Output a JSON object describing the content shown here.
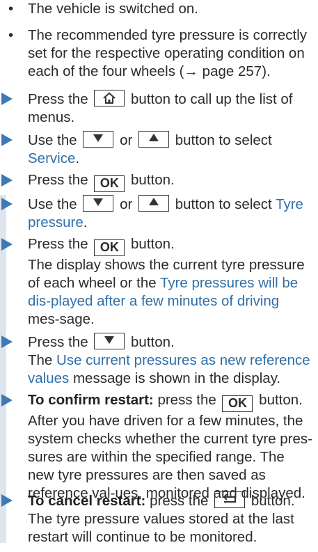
{
  "requirements": [
    "The vehicle is switched on.",
    "The recommended tyre pressure is correctly set for the respective operating condition on each of the four wheels (→ page 257)."
  ],
  "steps": {
    "s1": {
      "pre": "Press the",
      "post": "button to call up the list of menus."
    },
    "s2": {
      "pre": "Use the",
      "or": "or",
      "post": "button to select",
      "menu": "Service",
      "end": "."
    },
    "s3": {
      "pre": "Press the",
      "key": "OK",
      "post": "button."
    },
    "s4": {
      "pre": "Use the",
      "or": "or",
      "post": "button to select",
      "menu": "Tyre pressure",
      "end": "."
    },
    "s5": {
      "pre": "Press the",
      "key": "OK",
      "post": "button.",
      "result1": "The display shows the current tyre pressure of each wheel or the",
      "msg": "Tyre pressures will be dis-played after a few minutes of driving",
      "result2": "mes-sage."
    },
    "s6": {
      "pre": "Press the",
      "post": "button.",
      "result1": "The",
      "msg": "Use current pressures as new reference values",
      "result2": "message is shown in the display."
    },
    "s7": {
      "bold": "To confirm restart:",
      "pre": "press the",
      "key": "OK",
      "post": "button.",
      "result": "After you have driven for a few minutes, the system checks whether the current tyre pres-sures are within the specified range. The new tyre pressures are then saved as reference val-ues, monitored and displayed."
    },
    "s8": {
      "bold": "To cancel restart:",
      "pre": "press the",
      "post": "button.",
      "result": "The tyre pressure values stored at the last restart will continue to be monitored."
    }
  },
  "icons": {
    "home": "home-icon",
    "down": "down-triangle-icon",
    "up": "up-triangle-icon",
    "back": "back-arrow-icon"
  },
  "colors": {
    "accent": "#3d7ab5",
    "link_text": "#2f6fa8",
    "sidebar": "#dfe5ee"
  }
}
